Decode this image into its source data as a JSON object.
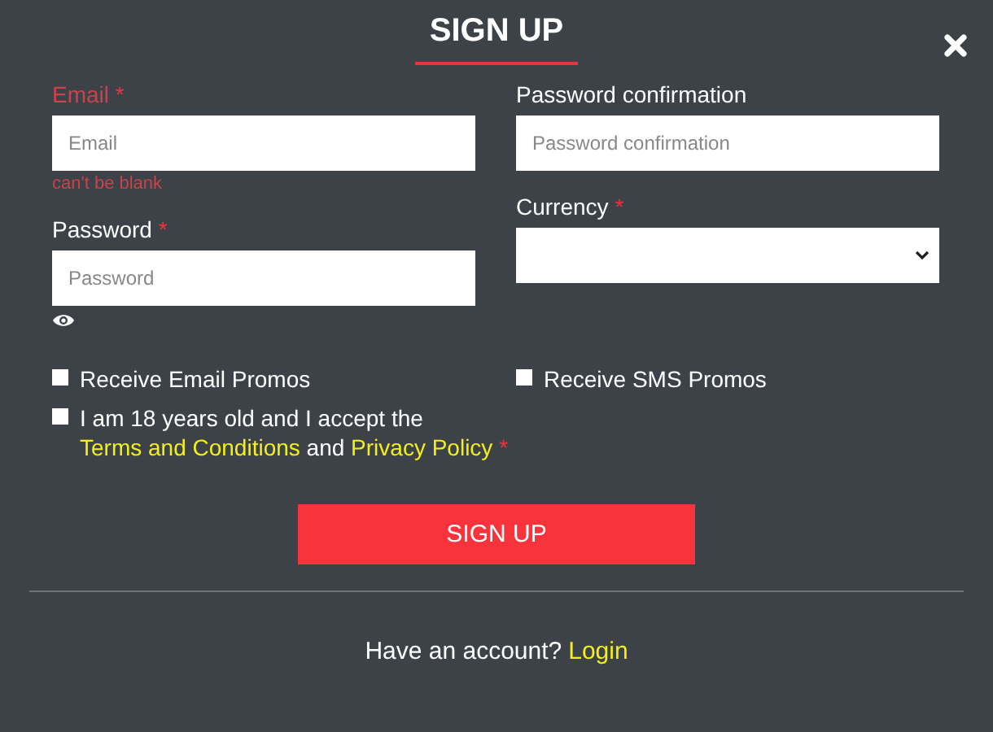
{
  "title": "SIGN UP",
  "fields": [
    {
      "kind": "input",
      "label": "Email",
      "required": "*",
      "placeholder": "Email",
      "error": true,
      "message": "can't be blank"
    },
    {
      "kind": "password",
      "label": "Password",
      "required": "*",
      "placeholder": "Password",
      "error": false
    },
    {
      "kind": "input",
      "label": "Password confirmation",
      "placeholder": "Password confirmation",
      "error": false
    },
    {
      "kind": "select",
      "label": "Currency",
      "required": "*",
      "error": false
    }
  ],
  "options": [
    {
      "kind": "plain",
      "label": "Receive Email Promos",
      "checked": false
    },
    {
      "kind": "plain",
      "label": "Receive SMS Promos",
      "checked": false
    },
    {
      "kind": "terms",
      "parts": [
        "I am 18 years old and I accept the",
        "Terms and Conditions",
        "and",
        "Privacy Policy",
        "*"
      ],
      "checked": false
    }
  ],
  "submit": "SIGN UP",
  "footer": {
    "text": "Have an account?",
    "link": "Login"
  }
}
